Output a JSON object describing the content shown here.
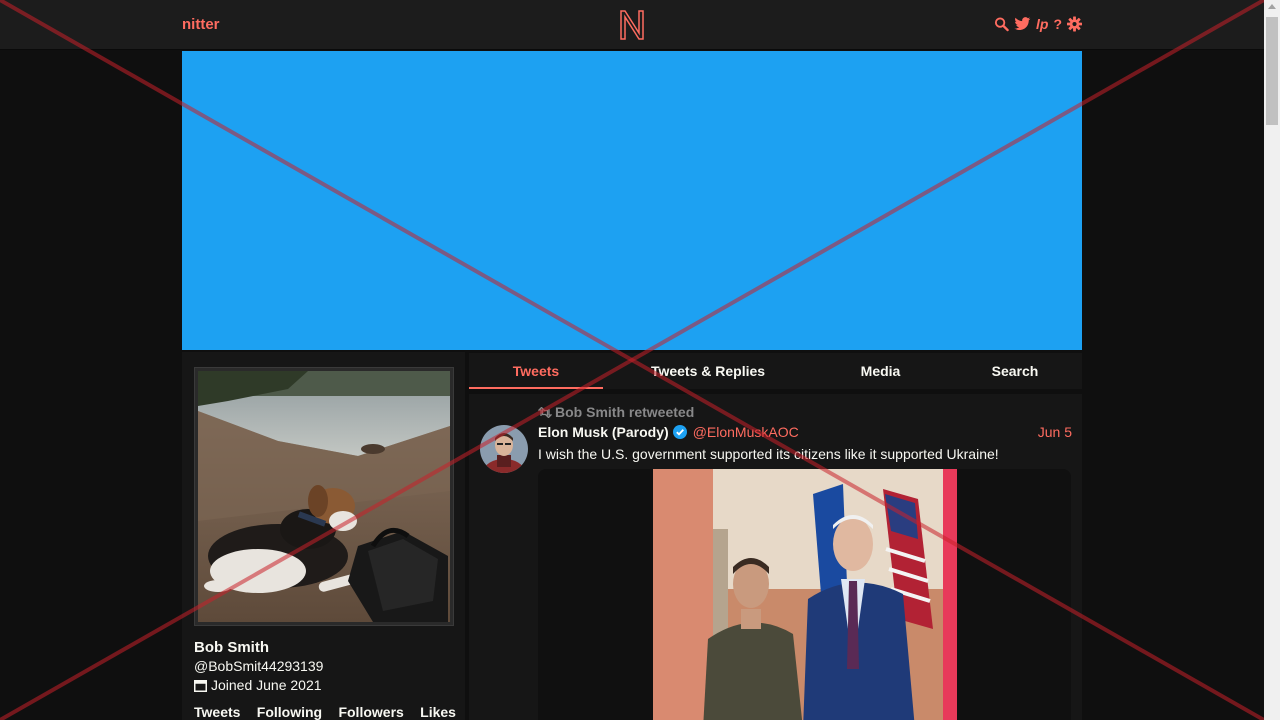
{
  "navbar": {
    "brand": "nitter",
    "logo_letter": "N",
    "icons": [
      "search-icon",
      "twitter-bird-icon",
      "liberapay-icon",
      "help-icon",
      "gear-icon"
    ],
    "liberapay_glyph": "lp",
    "help_glyph": "?"
  },
  "colors": {
    "accent": "#ff6c60",
    "banner": "#1da1f2",
    "background": "#0f0f0f",
    "panel": "#161616",
    "navbar": "#1c1c1c",
    "muted": "#888889"
  },
  "profile": {
    "fullname": "Bob Smith",
    "username": "@BobSmit44293139",
    "joined": "Joined June 2021",
    "stats": [
      "Tweets",
      "Following",
      "Followers",
      "Likes"
    ]
  },
  "timeline": {
    "tabs": [
      "Tweets",
      "Tweets & Replies",
      "Media",
      "Search"
    ],
    "active_tab": "Tweets"
  },
  "tweet": {
    "retweet_label": "Bob Smith retweeted",
    "fullname": "Elon Musk (Parody)",
    "username": "@ElonMuskAOC",
    "date": "Jun 5",
    "text": "I wish the U.S. government supported its citizens like it supported Ukraine!"
  }
}
